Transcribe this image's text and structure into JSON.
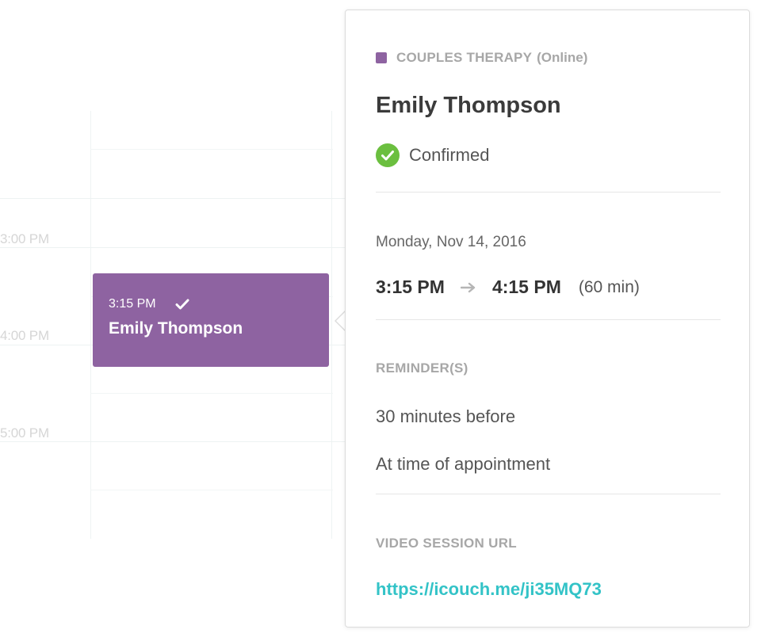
{
  "calendar": {
    "time_labels": [
      "3:00 PM",
      "4:00 PM",
      "5:00 PM"
    ],
    "event": {
      "time": "3:15 PM",
      "title": "Emily Thompson",
      "color": "#8e63a1"
    }
  },
  "popover": {
    "service_type": "COUPLES THERAPY",
    "session_mode": "(Online)",
    "service_color": "#8e63a1",
    "client_name": "Emily Thompson",
    "status": "Confirmed",
    "status_color": "#6bbf3f",
    "date": "Monday, Nov 14, 2016",
    "start_time": "3:15 PM",
    "end_time": "4:15 PM",
    "duration": "(60 min)",
    "reminders_heading": "REMINDER(S)",
    "reminders": [
      "30 minutes before",
      "At time of appointment"
    ],
    "video_heading": "VIDEO SESSION URL",
    "video_url": "https://icouch.me/ji35MQ73",
    "link_color": "#33c3c7"
  }
}
